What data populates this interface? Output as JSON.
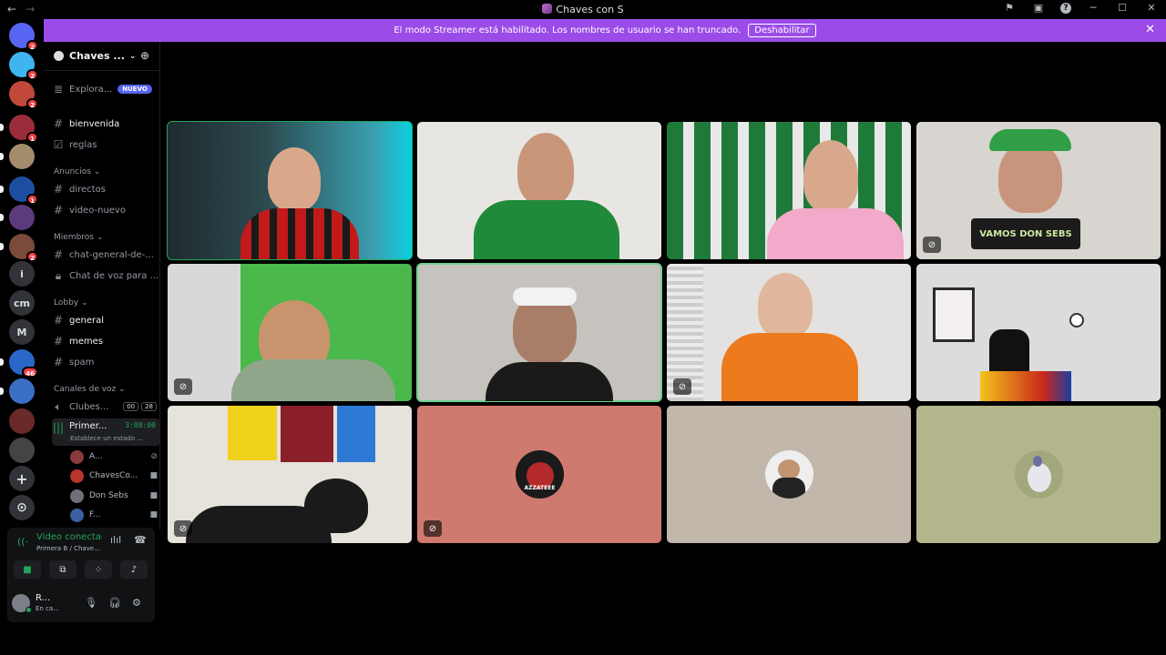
{
  "titlebar": {
    "title": "Chaves con S",
    "back_icon": "arrow-left-icon",
    "forward_icon": "arrow-right-icon",
    "actions": [
      "inbox-icon",
      "screen-icon",
      "help-icon"
    ],
    "minimize": "─",
    "maximize": "☐",
    "close": "✕"
  },
  "banner": {
    "text": "El modo Streamer está habilitado. Los nombres de usuario se han truncado.",
    "button": "Deshabilitar",
    "close": "✕"
  },
  "rail": {
    "servers": [
      {
        "label": "",
        "badge": "2",
        "color": "#5865f2"
      },
      {
        "label": "",
        "badge": "2",
        "color": "#3fb5f0"
      },
      {
        "label": "",
        "badge": "2",
        "color": "#c2483a"
      },
      {
        "label": "",
        "badge": "1",
        "color": "#9b2d3b"
      },
      {
        "label": "",
        "badge": "",
        "color": "#a38c6c"
      },
      {
        "label": "",
        "badge": "1",
        "color": "#1c4fa0"
      },
      {
        "label": "",
        "badge": "",
        "color": "#5c3a7d"
      },
      {
        "label": "",
        "badge": "2",
        "color": "#7a4a3a"
      },
      {
        "label": "i",
        "badge": "",
        "color": "#313338"
      },
      {
        "label": "cm",
        "badge": "",
        "color": "#313338"
      },
      {
        "label": "M",
        "badge": "",
        "color": "#313338"
      },
      {
        "label": "",
        "badge": "46",
        "color": "#2a67c9"
      },
      {
        "label": "",
        "badge": "",
        "color": "#3a6fc4"
      },
      {
        "label": "",
        "badge": "",
        "color": "#6a2a2a"
      },
      {
        "label": "",
        "badge": "",
        "color": "#444"
      }
    ],
    "add_label": "+",
    "explore_label": "⊙"
  },
  "sidebar": {
    "server_name": "Chaves ...",
    "explore": {
      "label": "Explora...",
      "badge": "NUEVO"
    },
    "channels": {
      "bienvenida": "bienvenida",
      "reglas": "reglas",
      "cat_anuncios": "Anuncios",
      "directos": "directos",
      "video_nuevo": "video-nuevo",
      "cat_miembros": "Miembros",
      "chat_general": "chat-general-de-...",
      "chat_voz": "Chat de voz para ...",
      "cat_lobby": "Lobby",
      "general": "general",
      "memes": "memes",
      "spam": "spam",
      "cat_voz": "Canales de voz",
      "clubes": "Clubes...",
      "clubes_n1": "00",
      "clubes_n2": "28",
      "primer": "Primer...",
      "primer_time": "3:08:00",
      "primer_status": "Establece un estado ..."
    },
    "members": [
      {
        "name": "A...",
        "color": "#8a3a3a"
      },
      {
        "name": "ChavesCo...",
        "color": "#b8342f"
      },
      {
        "name": "Don Sebs",
        "color": "#6f6f78"
      },
      {
        "name": "F...",
        "color": "#3a5fa0"
      }
    ]
  },
  "voice": {
    "status": "Video conectac",
    "sub": "Primera B / Chave...",
    "user_name": "R...",
    "user_status": "En ca..."
  },
  "tiles": {
    "t4_overlay": "VAMOS DON SEBS",
    "t10_avatar_text": "AZZATEEE"
  }
}
